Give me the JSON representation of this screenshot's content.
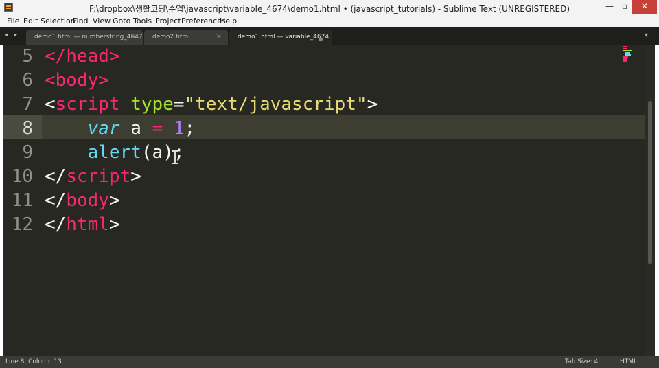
{
  "window": {
    "title": "F:\\dropbox\\생활코딩\\수업\\javascript\\variable_4674\\demo1.html • (javascript_tutorials) - Sublime Text (UNREGISTERED)",
    "minimize": "—",
    "maximize": "▫",
    "close": "✕"
  },
  "menu": [
    "File",
    "Edit",
    "Selection",
    "Find",
    "View",
    "Goto",
    "Tools",
    "Project",
    "Preferences",
    "Help"
  ],
  "tabbar": {
    "nav": "◂ ▸",
    "dropdown": "▾",
    "tabs": [
      {
        "label": "demo1.html — numberstring_4647",
        "close": "×"
      },
      {
        "label": "demo2.html",
        "close": "×"
      },
      {
        "label": "demo1.html — variable_4674",
        "modified": true
      }
    ]
  },
  "editor": {
    "current_line": 8,
    "lines": [
      {
        "num": "5",
        "tokens": [
          [
            "tag",
            "</"
          ],
          [
            "tag",
            "head"
          ],
          [
            "tag",
            ">"
          ]
        ]
      },
      {
        "num": "6",
        "tokens": [
          [
            "tag",
            "<"
          ],
          [
            "tag",
            "body"
          ],
          [
            "tag",
            ">"
          ]
        ]
      },
      {
        "num": "7",
        "tokens": [
          [
            "plain",
            "<"
          ],
          [
            "tag",
            "script"
          ],
          [
            "plain",
            " "
          ],
          [
            "attr",
            "type"
          ],
          [
            "plain",
            "="
          ],
          [
            "str",
            "\"text/javascript\""
          ],
          [
            "plain",
            ">"
          ]
        ]
      },
      {
        "num": "8",
        "tokens": [
          [
            "plain",
            "    "
          ],
          [
            "kw",
            "var"
          ],
          [
            "plain",
            " a "
          ],
          [
            "op",
            "="
          ],
          [
            "plain",
            " "
          ],
          [
            "num",
            "1"
          ],
          [
            "plain",
            ";"
          ]
        ]
      },
      {
        "num": "9",
        "tokens": [
          [
            "plain",
            "    "
          ],
          [
            "fn",
            "alert"
          ],
          [
            "plain",
            "(a);"
          ]
        ]
      },
      {
        "num": "10",
        "tokens": [
          [
            "plain",
            "</"
          ],
          [
            "tag",
            "script"
          ],
          [
            "plain",
            ">"
          ]
        ]
      },
      {
        "num": "11",
        "tokens": [
          [
            "plain",
            "</"
          ],
          [
            "tag",
            "body"
          ],
          [
            "plain",
            ">"
          ]
        ]
      },
      {
        "num": "12",
        "tokens": [
          [
            "plain",
            "</"
          ],
          [
            "tag",
            "html"
          ],
          [
            "plain",
            ">"
          ]
        ]
      }
    ]
  },
  "statusbar": {
    "position": "Line 8, Column 13",
    "tab_size": "Tab Size: 4",
    "syntax": "HTML"
  },
  "colors": {
    "background": "#272822",
    "tag": "#f92672",
    "attribute": "#a6e22e",
    "string": "#e6db74",
    "keyword": "#66d9ef",
    "number": "#ae81ff"
  }
}
